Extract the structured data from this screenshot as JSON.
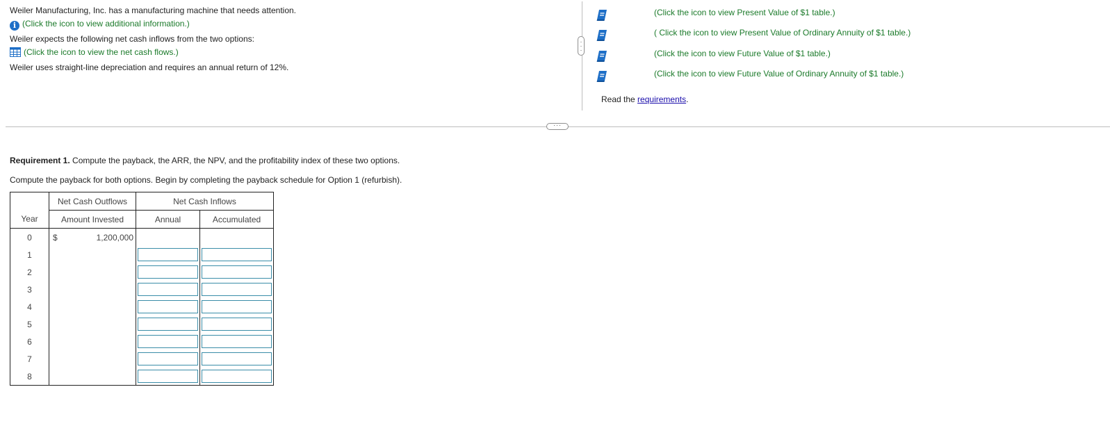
{
  "intro": {
    "line1": "Weiler Manufacturing, Inc. has a manufacturing machine that needs attention.",
    "info_link": "(Click the icon to view additional information.)",
    "line2": "Weiler expects the following net cash inflows from the two options:",
    "cash_link": "(Click the icon to view the net cash flows.)",
    "line3": "Weiler uses straight-line depreciation and requires an annual return of 12%."
  },
  "tables": [
    {
      "label": "(Click the icon to view Present Value of $1 table.)",
      "icon": "book-icon"
    },
    {
      "label": "( Click the icon to view Present Value of Ordinary Annuity of $1 table.)",
      "icon": "book-icon"
    },
    {
      "label": "(Click the icon to view Future Value of $1 table.)",
      "icon": "book-icon"
    },
    {
      "label": "(Click the icon to view Future Value of Ordinary Annuity of $1 table.)",
      "icon": "book-icon"
    }
  ],
  "read_req": {
    "prefix": "Read the ",
    "link": "requirements",
    "suffix": "."
  },
  "requirement": {
    "bold": "Requirement 1.",
    "text": " Compute the payback, the ARR, the NPV, and the profitability index of these two options.",
    "instruction": "Compute the payback for both options. Begin by completing the payback schedule for Option 1 (refurbish)."
  },
  "schedule": {
    "group_outflows": "Net Cash Outflows",
    "group_inflows": "Net Cash Inflows",
    "col_year": "Year",
    "col_invested": "Amount Invested",
    "col_annual": "Annual",
    "col_accumulated": "Accumulated",
    "currency": "$",
    "initial_investment": "1,200,000",
    "years": [
      "0",
      "1",
      "2",
      "3",
      "4",
      "5",
      "6",
      "7",
      "8"
    ]
  },
  "colors": {
    "link_green": "#1b7a2a",
    "link_blue": "#1a0dab",
    "input_border": "#3a8da8",
    "icon_blue": "#1e6fc7"
  }
}
